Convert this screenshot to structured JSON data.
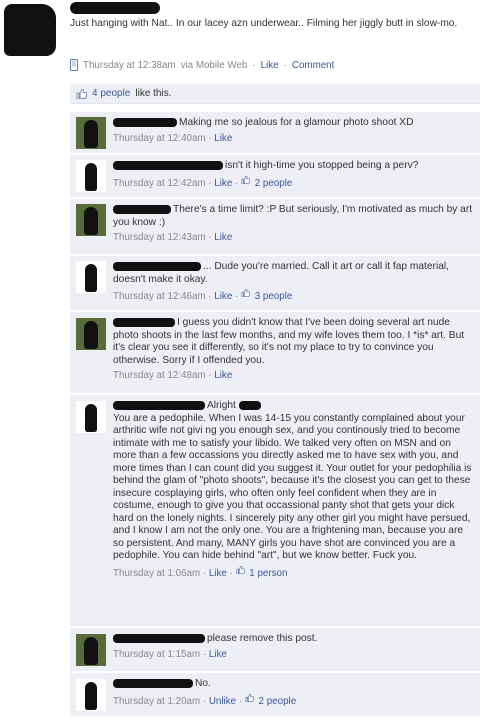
{
  "post": {
    "text": "Just hanging with Nat.. In our lacey azn underwear.. Filming her jiggly butt in slow-mo.",
    "time": "Thursday at 12:38am",
    "via": "via Mobile Web",
    "like_label": "Like",
    "comment_label": "Comment",
    "separator": "·"
  },
  "likes": {
    "people": "4 people",
    "suffix": "like this."
  },
  "comments": [
    {
      "text": "Making me so jealous for a glamour photo shoot XD",
      "time": "Thursday at 12:40am",
      "like": "Like",
      "like_count": ""
    },
    {
      "text": "isn't it high-time you stopped being a perv?",
      "time": "Thursday at 12:42am",
      "like": "Like",
      "like_count": "2 people"
    },
    {
      "text": "There's a time limit? :P But seriously, I'm motivated as much by art you know :)",
      "time": "Thursday at 12:43am",
      "like": "Like",
      "like_count": ""
    },
    {
      "text": "... Dude you're married. Call it art or call it fap material, doesn't make it okay.",
      "time": "Thursday at 12:46am",
      "like": "Like",
      "like_count": "3 people"
    },
    {
      "text": "I guess you didn't know that I've been doing several art nude photo shoots in the last few months, and my wife loves them too. I *is* art. But it's clear you see it differently, so it's not my place to try to convince you otherwise. Sorry if I offended you.",
      "time": "Thursday at 12:48am",
      "like": "Like",
      "like_count": ""
    },
    {
      "header": "Alright",
      "text": "You are a pedophile. When I was 14-15 you constantly complained about your arthritic wife not givi ng you enough sex, and you continously tried to become intimate with me to satisfy your libido. We talked very often on MSN and on more than a few occassions you directly asked me to have sex with you, and more times than I can count did you suggest it. Your outlet for your pedophilia is behind the glam of \"photo shoots\", because it's the closest you can get to these insecure cosplaying girls, who often only feel confident when they are in costume, enough to give you that occassional panty shot that gets your dick hard on the lonely nights. I sincerely pity any other girl you might have persued, and I know I am not the only one. You are a frightening man, because you are so persistent. And many, MANY girls you have shot are convinced you are a pedophile. You can hide behind \"art\", but we know better. Fuck you.",
      "time": "Thursday at 1:06am",
      "like": "Like",
      "like_count": "1 person"
    },
    {
      "text": "please remove this post.",
      "time": "Thursday at 1:15am",
      "like": "Like",
      "like_count": ""
    },
    {
      "text": "No.",
      "time": "Thursday at 1:20am",
      "like": "Unlike",
      "like_count": "2 people"
    }
  ]
}
